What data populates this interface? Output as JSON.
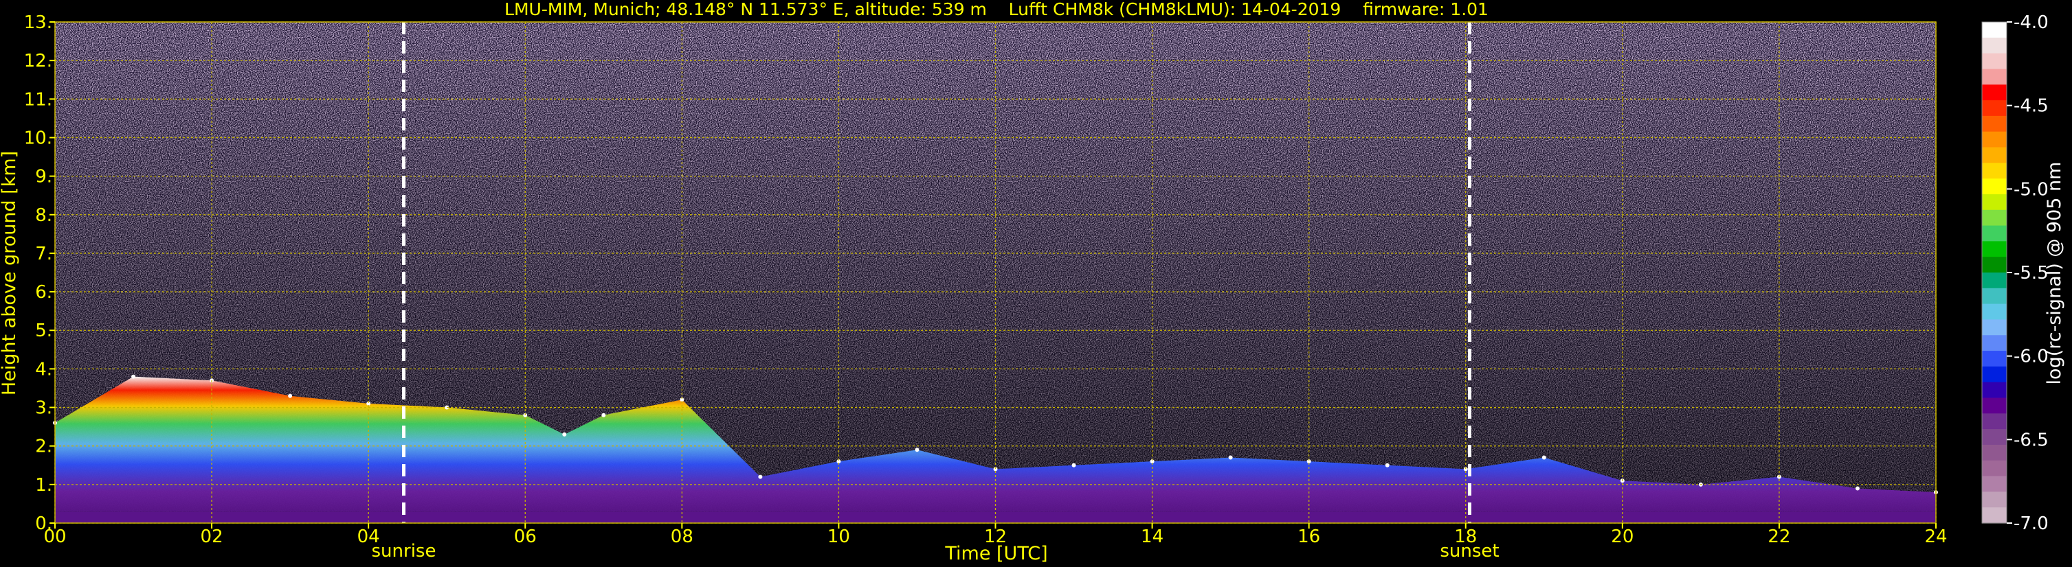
{
  "chart_data": {
    "type": "heatmap",
    "title": "LMU-MIM, Munich; 48.148° N 11.573° E, altitude: 539 m    Lufft CHM8k (CHM8kLMU): 14-04-2019    firmware: 1.01",
    "xlabel": "Time [UTC]",
    "ylabel": "Height above ground [km]",
    "xlim": [
      0,
      24
    ],
    "ylim": [
      0,
      13
    ],
    "x_ticks": [
      "00",
      "02",
      "04",
      "06",
      "08",
      "10",
      "12",
      "14",
      "16",
      "18",
      "20",
      "22",
      "24"
    ],
    "y_ticks": [
      "0.",
      "1.",
      "2.",
      "3.",
      "4.",
      "5.",
      "6.",
      "7.",
      "8.",
      "9.",
      "10.",
      "11.",
      "12.",
      "13."
    ],
    "grid": true,
    "events": [
      {
        "label": "sunrise",
        "time": 4.45
      },
      {
        "label": "sunset",
        "time": 18.05
      }
    ],
    "colorbar": {
      "label": "log(rc-signal) @ 905 nm",
      "range": [
        -7.0,
        -4.0
      ],
      "ticks": [
        "-4.0",
        "-4.5",
        "-5.0",
        "-5.5",
        "-6.0",
        "-6.5",
        "-7.0"
      ],
      "colors": [
        "#ffffff",
        "#f0e0e0",
        "#f4c8c8",
        "#f4a0a0",
        "#ff0000",
        "#ff3000",
        "#ff6000",
        "#ff9000",
        "#ffb000",
        "#ffd800",
        "#ffff00",
        "#c8f000",
        "#80e040",
        "#40d060",
        "#00c000",
        "#009000",
        "#00a878",
        "#40c0c0",
        "#60c8e8",
        "#80b8f8",
        "#6088f8",
        "#3050f8",
        "#0020e0",
        "#3000b0",
        "#600090",
        "#703090",
        "#804890",
        "#905890",
        "#a06898",
        "#b080a8",
        "#c0a0b8",
        "#d0b8c8"
      ]
    },
    "layers": [
      {
        "time": 0.0,
        "base_km": 0.3,
        "top_km": 2.6
      },
      {
        "time": 1.0,
        "base_km": 0.3,
        "top_km": 3.8
      },
      {
        "time": 2.0,
        "base_km": 0.3,
        "top_km": 3.7
      },
      {
        "time": 3.0,
        "base_km": 0.3,
        "top_km": 3.3
      },
      {
        "time": 4.0,
        "base_km": 0.3,
        "top_km": 3.1
      },
      {
        "time": 5.0,
        "base_km": 0.3,
        "top_km": 3.0
      },
      {
        "time": 6.0,
        "base_km": 0.3,
        "top_km": 2.8
      },
      {
        "time": 6.5,
        "base_km": 0.3,
        "top_km": 2.3
      },
      {
        "time": 7.0,
        "base_km": 0.3,
        "top_km": 2.8
      },
      {
        "time": 8.0,
        "base_km": 0.3,
        "top_km": 3.2
      },
      {
        "time": 9.0,
        "base_km": 0.3,
        "top_km": 1.2
      },
      {
        "time": 10.0,
        "base_km": 0.3,
        "top_km": 1.6
      },
      {
        "time": 11.0,
        "base_km": 0.3,
        "top_km": 1.9
      },
      {
        "time": 12.0,
        "base_km": 0.3,
        "top_km": 1.4
      },
      {
        "time": 13.0,
        "base_km": 0.3,
        "top_km": 1.5
      },
      {
        "time": 14.0,
        "base_km": 0.3,
        "top_km": 1.6
      },
      {
        "time": 15.0,
        "base_km": 0.3,
        "top_km": 1.7
      },
      {
        "time": 16.0,
        "base_km": 0.3,
        "top_km": 1.6
      },
      {
        "time": 17.0,
        "base_km": 0.3,
        "top_km": 1.5
      },
      {
        "time": 18.0,
        "base_km": 0.3,
        "top_km": 1.4
      },
      {
        "time": 19.0,
        "base_km": 0.3,
        "top_km": 1.7
      },
      {
        "time": 20.0,
        "base_km": 0.3,
        "top_km": 1.1
      },
      {
        "time": 21.0,
        "base_km": 0.3,
        "top_km": 1.0
      },
      {
        "time": 22.0,
        "base_km": 0.3,
        "top_km": 1.2
      },
      {
        "time": 23.0,
        "base_km": 0.3,
        "top_km": 0.9
      },
      {
        "time": 24.0,
        "base_km": 0.3,
        "top_km": 0.8
      }
    ]
  }
}
